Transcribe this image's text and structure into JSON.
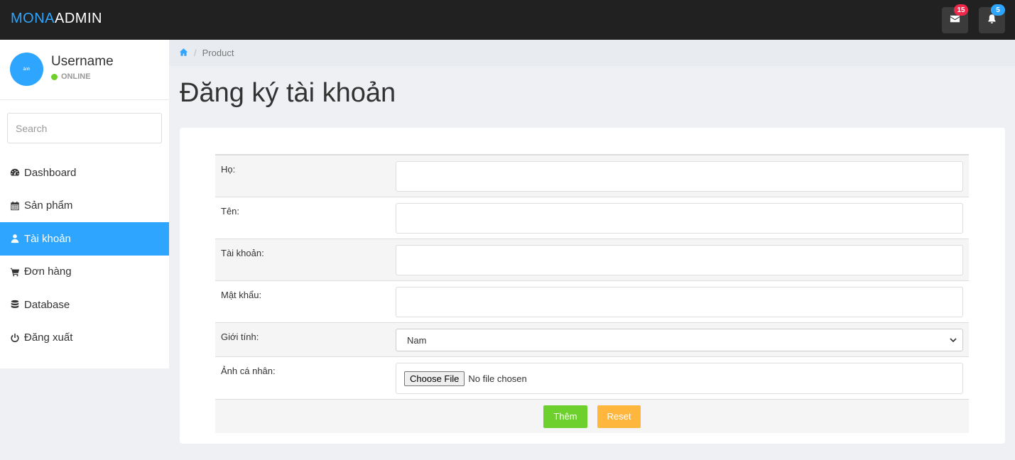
{
  "brand": {
    "part1": "MONA",
    "part2": "ADMIN"
  },
  "topbar": {
    "messages_badge": "15",
    "notifications_badge": "5"
  },
  "user": {
    "avatar_text": "ảnh",
    "name": "Username",
    "status": "ONLINE"
  },
  "sidebar": {
    "search_placeholder": "Search",
    "items": [
      {
        "label": "Dashboard",
        "icon": "dashboard-icon"
      },
      {
        "label": "Sản phẩm",
        "icon": "calendar-icon"
      },
      {
        "label": "Tài khoản",
        "icon": "user-icon",
        "active": true
      },
      {
        "label": "Đơn hàng",
        "icon": "cart-icon"
      },
      {
        "label": "Database",
        "icon": "database-icon"
      },
      {
        "label": "Đăng xuất",
        "icon": "power-icon"
      }
    ]
  },
  "breadcrumb": {
    "current": "Product"
  },
  "page": {
    "title": "Đăng ký tài khoản"
  },
  "form": {
    "fields": {
      "ho": "Họ:",
      "ten": "Tên:",
      "taikhoan": "Tài khoản:",
      "matkhau": "Mật khẩu:",
      "gioitinh": "Giới tính:",
      "anh": "Ảnh cá nhân:"
    },
    "gender_selected": "Nam",
    "file_button": "Choose File",
    "file_status": "No file chosen",
    "submit": "Thêm",
    "reset": "Reset"
  },
  "colors": {
    "accent": "#2ea6ff",
    "topbar": "#212121",
    "success": "#6dd02c",
    "warning": "#ffb63d",
    "danger": "#f02849"
  }
}
